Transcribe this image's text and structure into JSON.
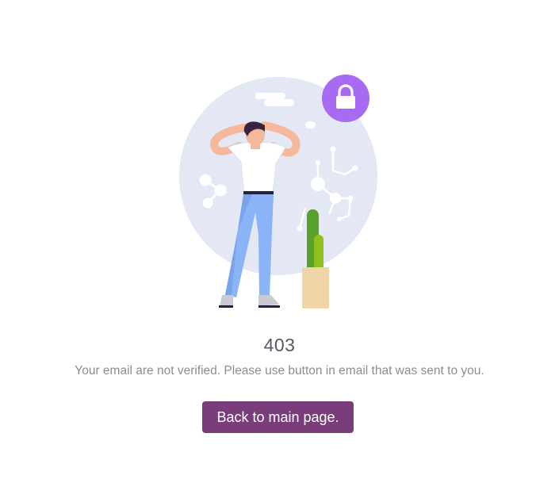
{
  "error": {
    "code": "403",
    "message": "Your email are not verified. Please use button in email that was sent to you."
  },
  "actions": {
    "back_label": "Back to main page."
  },
  "illustration": {
    "icon": "lock-icon",
    "subject": "confused-man-with-hands-on-head",
    "accent_color": "#a66bf0",
    "circle_color": "#e4e7f4"
  },
  "colors": {
    "button_bg": "#7a3d7c",
    "button_text": "#ffffff",
    "title_text": "#555b63",
    "message_text": "#8a8d91"
  }
}
